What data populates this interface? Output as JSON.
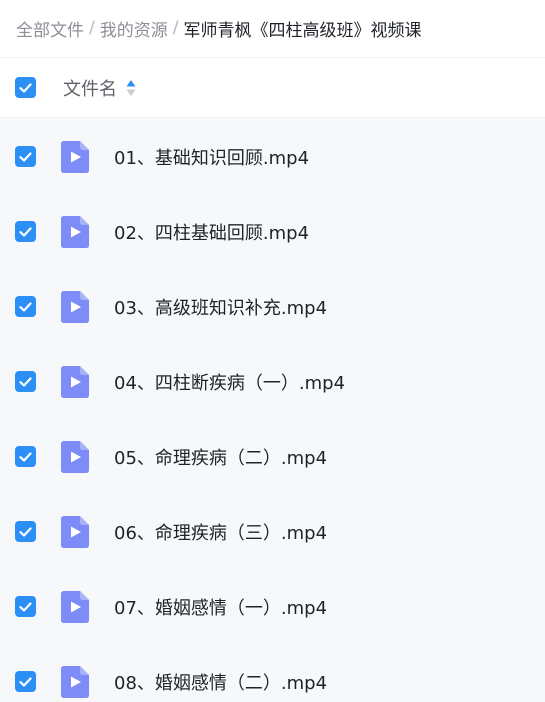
{
  "breadcrumb": {
    "items": [
      "全部文件",
      "我的资源"
    ],
    "separator": "/",
    "current": "军师青枫《四柱高级班》视频课"
  },
  "list_header": {
    "select_all_checked": true,
    "column_title": "文件名",
    "sort_icon": "sort-updown-icon"
  },
  "files": [
    {
      "name": "01、基础知识回顾.mp4",
      "checked": true,
      "icon": "video-file-icon"
    },
    {
      "name": "02、四柱基础回顾.mp4",
      "checked": true,
      "icon": "video-file-icon"
    },
    {
      "name": "03、高级班知识补充.mp4",
      "checked": true,
      "icon": "video-file-icon"
    },
    {
      "name": "04、四柱断疾病（一）.mp4",
      "checked": true,
      "icon": "video-file-icon"
    },
    {
      "name": "05、命理疾病（二）.mp4",
      "checked": true,
      "icon": "video-file-icon"
    },
    {
      "name": "06、命理疾病（三）.mp4",
      "checked": true,
      "icon": "video-file-icon"
    },
    {
      "name": "07、婚姻感情（一）.mp4",
      "checked": true,
      "icon": "video-file-icon"
    },
    {
      "name": "08、婚姻感情（二）.mp4",
      "checked": true,
      "icon": "video-file-icon"
    }
  ],
  "colors": {
    "accent": "#2b8ff6",
    "file_icon": "#7e8cf7",
    "list_background": "#f7f8fa"
  }
}
